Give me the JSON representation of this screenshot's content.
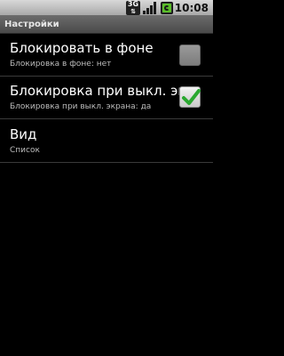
{
  "status_bar": {
    "network_label": "3G",
    "network_icon": "network-3g-icon",
    "signal_icon": "signal-icon",
    "battery_icon": "battery-charging-icon",
    "time": "10:08"
  },
  "title_bar": {
    "title": "Настройки"
  },
  "preferences": [
    {
      "title": "Блокировать в фоне",
      "summary": "Блокировка в фоне: нет",
      "checked": false,
      "enabled": false
    },
    {
      "title": "Блокировка при выкл. экр",
      "summary": "Блокировка при выкл. экрана: да",
      "checked": true,
      "enabled": true
    },
    {
      "title": "Вид",
      "summary": "Список"
    }
  ],
  "colors": {
    "background": "#000000",
    "check_accent": "#2aa830"
  }
}
